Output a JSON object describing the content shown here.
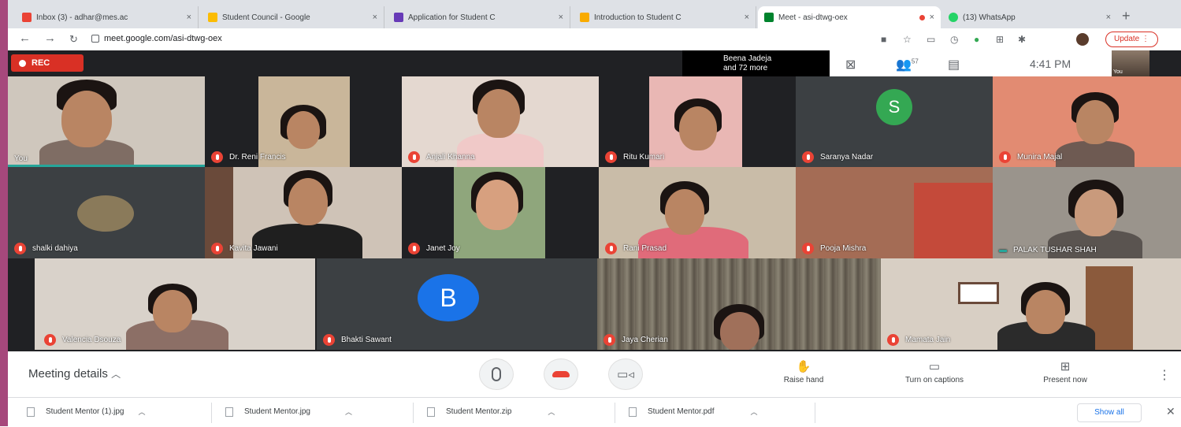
{
  "browser": {
    "tabs": [
      {
        "title": "Inbox (3) - adhar@mes.ac",
        "favicon_color": "#ea4335"
      },
      {
        "title": "Student Council - Google",
        "favicon_color": "#fbbc04"
      },
      {
        "title": "Application for Student C",
        "favicon_color": "#673ab7"
      },
      {
        "title": "Introduction to Student C",
        "favicon_color": "#f9ab00"
      },
      {
        "title": "Meet - asi-dtwg-oex",
        "favicon_color": "#00832d"
      },
      {
        "title": "(13) WhatsApp",
        "favicon_color": "#25d366"
      }
    ],
    "tab_close": "×",
    "new_tab": "+",
    "url": "meet.google.com/asi-dtwg-oex",
    "update_label": "Update"
  },
  "meet": {
    "rec_label": "REC",
    "people_line1": "Beena Jadeja",
    "people_line2": "and 72 more",
    "participant_count": "57",
    "time": "4:41 PM",
    "self_label": "You",
    "participants": [
      {
        "name": "You"
      },
      {
        "name": "Dr. Reni Francis"
      },
      {
        "name": "Anjali Khanna"
      },
      {
        "name": "Ritu Kumari"
      },
      {
        "name": "Saranya Nadar",
        "avatar_letter": "S",
        "avatar_color": "#34a853"
      },
      {
        "name": "Munira Majal"
      },
      {
        "name": "shalki dahiya"
      },
      {
        "name": "Kavita Jawani"
      },
      {
        "name": "Janet Joy"
      },
      {
        "name": "Rani Prasad"
      },
      {
        "name": "Pooja Mishra"
      },
      {
        "name": "PALAK TUSHAR SHAH"
      },
      {
        "name": "Valencia Dsouza"
      },
      {
        "name": "Bhakti Sawant",
        "avatar_letter": "B",
        "avatar_color": "#1a73e8"
      },
      {
        "name": "Jaya Cherian"
      },
      {
        "name": "Mamata Jain"
      }
    ]
  },
  "controls": {
    "meeting_details": "Meeting details",
    "raise_hand": "Raise hand",
    "captions": "Turn on captions",
    "present": "Present now"
  },
  "downloads": {
    "items": [
      "Student Mentor (1).jpg",
      "Student Mentor.jpg",
      "Student Mentor.zip",
      "Student Mentor.pdf"
    ],
    "show_all": "Show all"
  }
}
